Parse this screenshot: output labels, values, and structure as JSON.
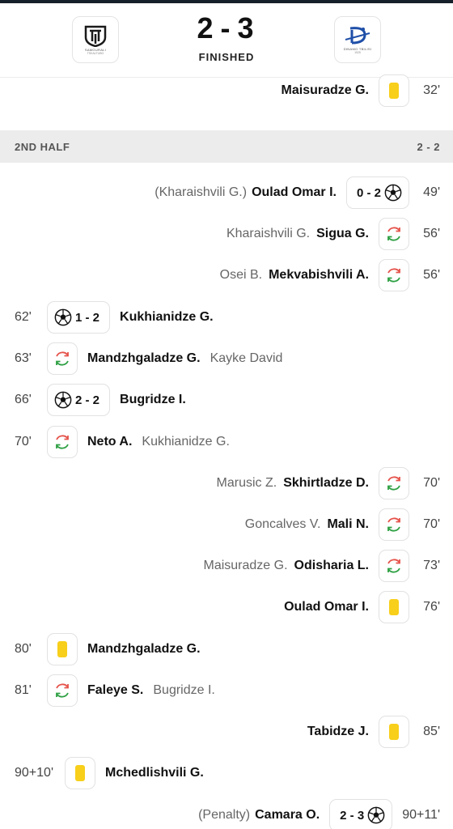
{
  "header": {
    "score_home": "2",
    "score_away": "3",
    "score_dash": "-",
    "status": "FINISHED",
    "home_logo_caption": "SAMGURALI",
    "home_logo_sub": "TSKALTUBO",
    "away_logo_caption": "DINAMO TBILISI",
    "away_logo_sub": "1925"
  },
  "colors": {
    "yellow_card": "#f8cf1a",
    "sub_in": "#2ea043",
    "sub_out": "#e5534b",
    "section_bg": "#ececec"
  },
  "events_top": [
    {
      "side": "away",
      "type": "yellow-card",
      "player": "Maisuradze G.",
      "minute": "32'"
    }
  ],
  "second_half": {
    "label": "2ND HALF",
    "score": "2 - 2"
  },
  "events": [
    {
      "side": "away",
      "type": "goal",
      "player": "Oulad Omar I.",
      "assist": "(Kharaishvili G.)",
      "score": "0 - 2",
      "minute": "49'"
    },
    {
      "side": "away",
      "type": "substitution",
      "player": "Sigua G.",
      "sub_out": "Kharaishvili G.",
      "minute": "56'"
    },
    {
      "side": "away",
      "type": "substitution",
      "player": "Mekvabishvili A.",
      "sub_out": "Osei B.",
      "minute": "56'"
    },
    {
      "side": "home",
      "type": "goal",
      "player": "Kukhianidze G.",
      "score": "1 - 2",
      "minute": "62'"
    },
    {
      "side": "home",
      "type": "substitution",
      "player": "Mandzhgaladze G.",
      "sub_out": "Kayke David",
      "minute": "63'"
    },
    {
      "side": "home",
      "type": "goal",
      "player": "Bugridze I.",
      "score": "2 - 2",
      "minute": "66'"
    },
    {
      "side": "home",
      "type": "substitution",
      "player": "Neto A.",
      "sub_out": "Kukhianidze G.",
      "minute": "70'"
    },
    {
      "side": "away",
      "type": "substitution",
      "player": "Skhirtladze D.",
      "sub_out": "Marusic Z.",
      "minute": "70'"
    },
    {
      "side": "away",
      "type": "substitution",
      "player": "Mali N.",
      "sub_out": "Goncalves V.",
      "minute": "70'"
    },
    {
      "side": "away",
      "type": "substitution",
      "player": "Odisharia L.",
      "sub_out": "Maisuradze G.",
      "minute": "73'"
    },
    {
      "side": "away",
      "type": "yellow-card",
      "player": "Oulad Omar I.",
      "minute": "76'"
    },
    {
      "side": "home",
      "type": "yellow-card",
      "player": "Mandzhgaladze G.",
      "minute": "80'"
    },
    {
      "side": "home",
      "type": "substitution",
      "player": "Faleye S.",
      "sub_out": "Bugridze I.",
      "minute": "81'"
    },
    {
      "side": "away",
      "type": "yellow-card",
      "player": "Tabidze J.",
      "minute": "85'"
    },
    {
      "side": "home",
      "type": "yellow-card",
      "player": "Mchedlishvili G.",
      "minute": "90+10'"
    },
    {
      "side": "away",
      "type": "goal",
      "player": "Camara O.",
      "assist": "(Penalty)",
      "score": "2 - 3",
      "minute": "90+11'"
    }
  ]
}
